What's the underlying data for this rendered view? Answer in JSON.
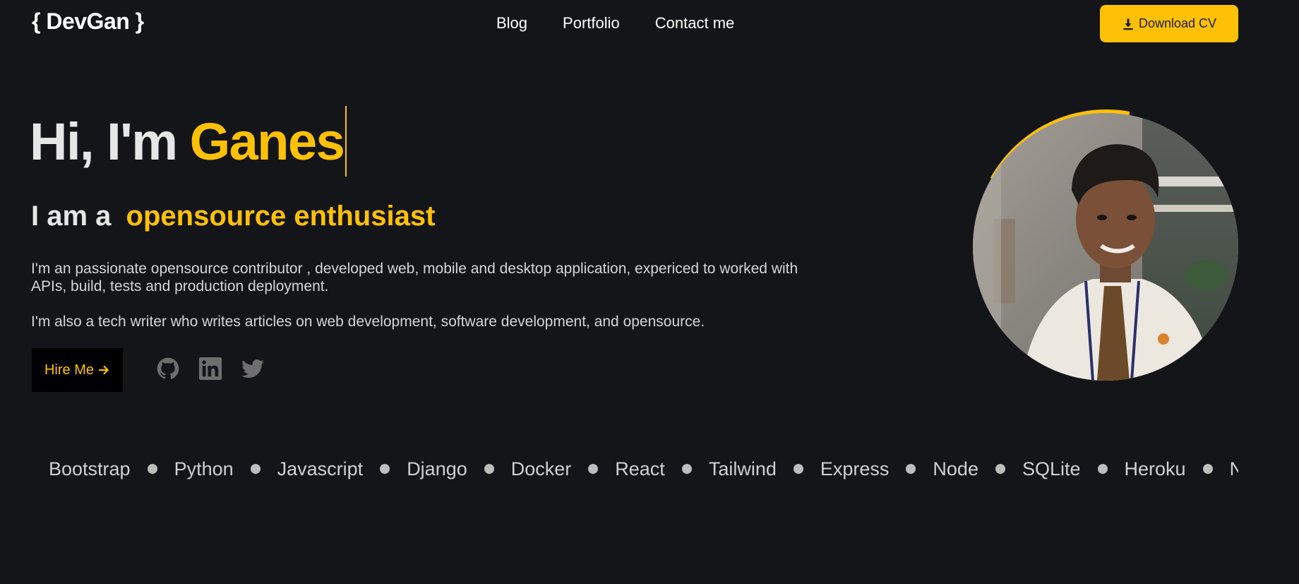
{
  "nav": {
    "logo": "{ DevGan }",
    "links": [
      "Blog",
      "Portfolio",
      "Contact me"
    ],
    "cv_button": "Download CV"
  },
  "hero": {
    "greeting": "Hi, I'm",
    "name_typed": "Ganes",
    "role_prefix": "I am a",
    "role": "opensource enthusiast",
    "para1": "I'm an passionate opensource contributor , developed web, mobile and desktop application, expericed to worked with APIs, build, tests and production deployment.",
    "para2": "I'm also a tech writer who writes articles on web development, software development, and opensource.",
    "hire_button": "Hire Me"
  },
  "socials": [
    {
      "name": "github-icon"
    },
    {
      "name": "linkedin-icon"
    },
    {
      "name": "twitter-icon"
    }
  ],
  "skills": [
    "Bootstrap",
    "Python",
    "Javascript",
    "Django",
    "Docker",
    "React",
    "Tailwind",
    "Express",
    "Node",
    "SQLite",
    "Heroku",
    "Netlify"
  ],
  "colors": {
    "background": "#141518",
    "accent": "#ffc107",
    "text": "#ececec",
    "muted_icon": "#6e6e6e"
  }
}
